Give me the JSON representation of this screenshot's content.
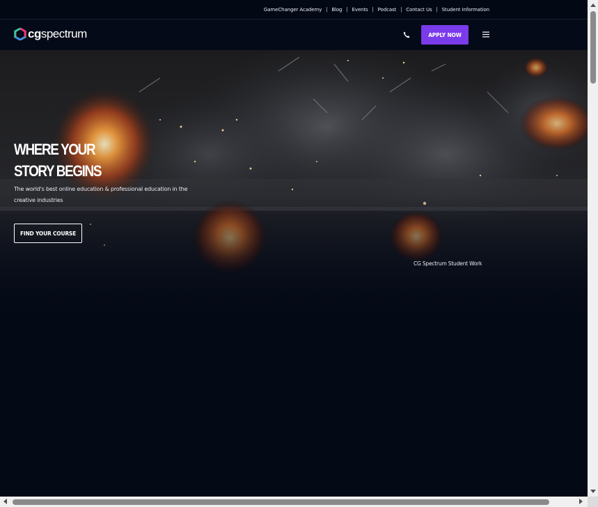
{
  "utility_nav": {
    "items": [
      {
        "label": "GameChanger Academy"
      },
      {
        "label": "Blog"
      },
      {
        "label": "Events"
      },
      {
        "label": "Podcast"
      },
      {
        "label": "Contact Us"
      },
      {
        "label": "Student Information"
      }
    ],
    "separator": "|"
  },
  "header": {
    "logo_bold": "cg",
    "logo_light": "spectrum",
    "apply_label": "APPLY NOW",
    "phone_icon": "phone-icon",
    "menu_icon": "hamburger-menu-icon"
  },
  "hero": {
    "title_line1": "WHERE YOUR",
    "title_line2": "STORY BEGINS",
    "subtitle": "The world's best online education & professional education in the creative industries",
    "cta_label": "FIND YOUR COURSE",
    "caption": "CG Spectrum Student Work"
  },
  "colors": {
    "background": "#040916",
    "accent": "#7a3bea",
    "text": "#ffffff"
  }
}
